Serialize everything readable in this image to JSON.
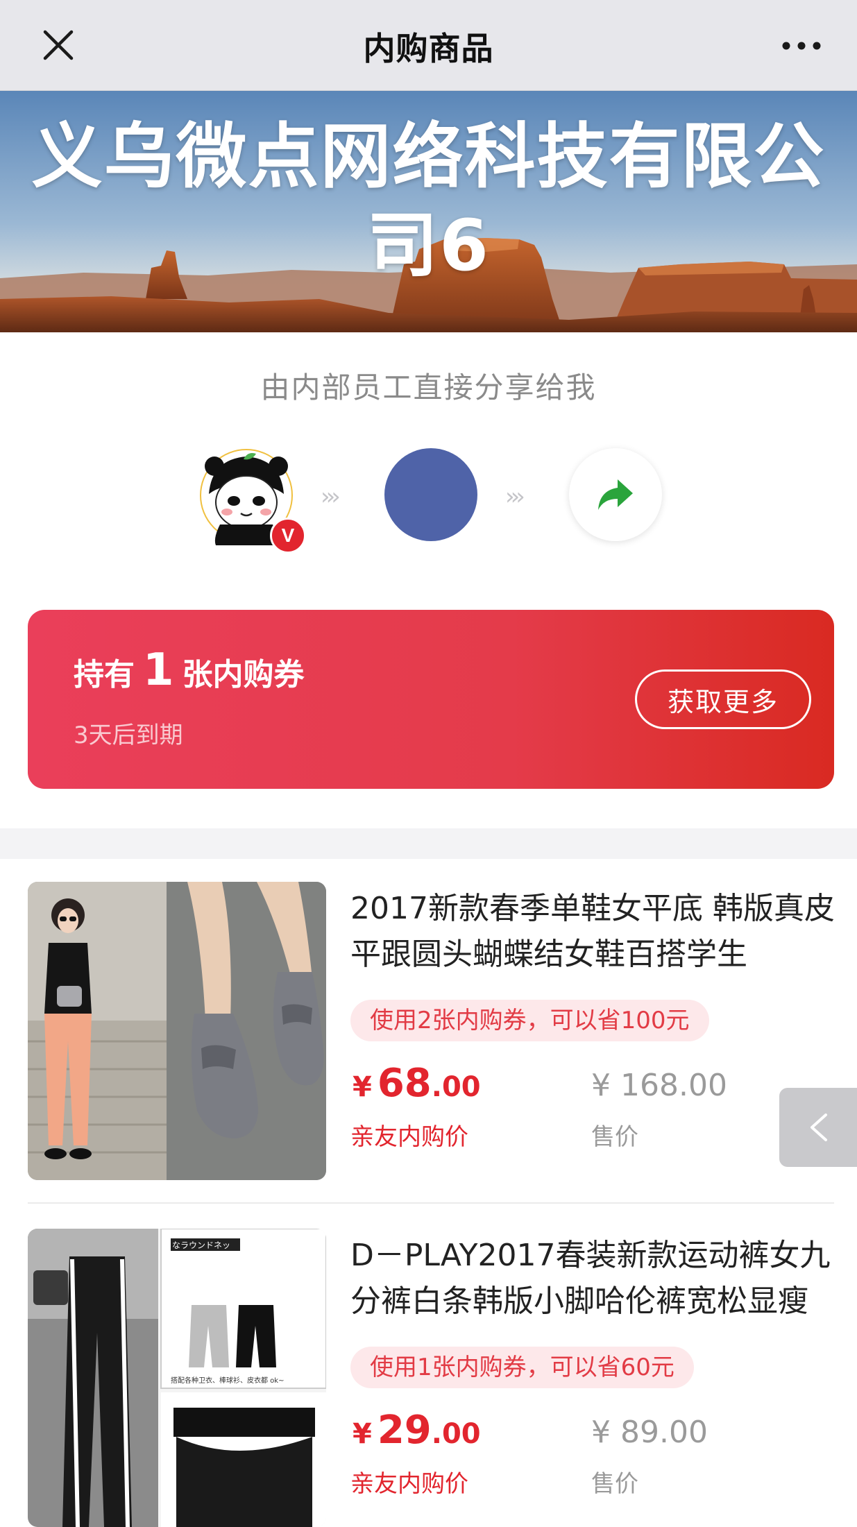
{
  "navbar": {
    "title": "内购商品",
    "close_icon": "close-icon",
    "more_icon": "more-icon"
  },
  "banner": {
    "title": "义乌微点网络科技有限公司6"
  },
  "share": {
    "text": "由内部员工直接分享给我",
    "arrows": "›››",
    "badge_letter": "V"
  },
  "coupon": {
    "prefix": "持有",
    "count": "1",
    "suffix": "张内购券",
    "expiry": "3天后到期",
    "button": "获取更多"
  },
  "products": [
    {
      "title": "2017新款春季单鞋女平底 韩版真皮平跟圆头蝴蝶结女鞋百搭学生",
      "save": "使用2张内购券，可以省100元",
      "currency": "¥",
      "price_int": "68",
      "price_dec": ".00",
      "price_label": "亲友内购价",
      "orig_price": "¥ 168.00",
      "orig_label": "售价"
    },
    {
      "title": "D－PLAY2017春装新款运动裤女九分裤白条韩版小脚哈伦裤宽松显瘦",
      "save": "使用1张内购券，可以省60元",
      "currency": "¥",
      "price_int": "29",
      "price_dec": ".00",
      "price_label": "亲友内购价",
      "orig_price": "¥ 89.00",
      "orig_label": "售价",
      "image_texts": [
        "なラウンドネッ",
        "搭配各种卫衣、棒球衫、皮衣都 ok~"
      ]
    }
  ],
  "side_tab": {
    "icon": "chevron-left-icon"
  },
  "colors": {
    "accent": "#e2252e",
    "coupon_start": "#ea3f5a",
    "coupon_end": "#d92a22",
    "avatar_blue": "#4f63a8",
    "share_green": "#2aa43c"
  }
}
